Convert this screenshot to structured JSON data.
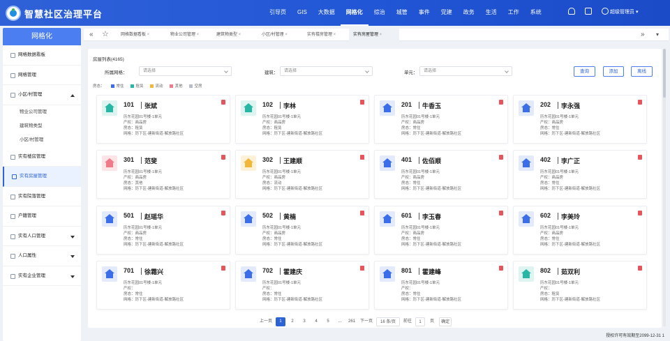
{
  "app": {
    "title": "智慧社区治理平台",
    "user": "超级管理员"
  },
  "nav": [
    "引导页",
    "GIS",
    "大数据",
    "网格化",
    "综治",
    "城管",
    "事件",
    "党建",
    "政务",
    "生活",
    "工作",
    "系统"
  ],
  "nav_active": 3,
  "sidebar": {
    "title": "网格化",
    "items": [
      {
        "label": "网格数据看板"
      },
      {
        "label": "网格管理"
      },
      {
        "label": "小区/村管理",
        "caret": "up"
      },
      {
        "label": "物业公司管理",
        "sub": true
      },
      {
        "label": "建筑物类型",
        "sub": true
      },
      {
        "label": "小区/村管理",
        "sub": true
      },
      {
        "label": "实有楼房管理"
      },
      {
        "label": "实有房屋管理",
        "active": true
      },
      {
        "label": "实有院落管理"
      },
      {
        "label": "户籍管理"
      },
      {
        "label": "实有人口管理",
        "caret": "down"
      },
      {
        "label": "人口属性",
        "caret": "down"
      },
      {
        "label": "实有企业管理",
        "caret": "down"
      }
    ]
  },
  "tabs": [
    "网格数据看板",
    "物业公司管理",
    "建筑物类型",
    "小区/村管理",
    "实有楼房管理",
    "实有房屋管理"
  ],
  "tab_active": 5,
  "panel": {
    "title": "房屋列表(4165)",
    "filters": [
      {
        "label": "所属网格：",
        "placeholder": "请选择"
      },
      {
        "label": "建筑：",
        "placeholder": "请选择"
      },
      {
        "label": "单元：",
        "placeholder": "请选择"
      }
    ],
    "buttons": [
      "查询",
      "添加",
      "离线"
    ],
    "legend_label": "房态：",
    "legend": [
      {
        "label": "常住",
        "color": "#3b6ee8"
      },
      {
        "label": "租赁",
        "color": "#27b7a4"
      },
      {
        "label": "流动",
        "color": "#f2b63a"
      },
      {
        "label": "其他",
        "color": "#f07a8a"
      },
      {
        "label": "空房",
        "color": "#b8bec8"
      }
    ]
  },
  "line_labels": {
    "owner": "产权：",
    "status": "房态：",
    "grid": "网格："
  },
  "cards": [
    {
      "room": "101",
      "name": "张斌",
      "addr": "历东花园01号楼-1单元",
      "owner": "商品房",
      "status": "租赁",
      "grid": "历下区-建新街道-解放路社区",
      "color": "#27b7a4",
      "bg": "#ddf4f1"
    },
    {
      "room": "102",
      "name": "李林",
      "addr": "历东花园01号楼-1单元",
      "owner": "商品房",
      "status": "租赁",
      "grid": "历下区-建新街道-解放路社区",
      "color": "#27b7a4",
      "bg": "#ddf4f1"
    },
    {
      "room": "201",
      "name": "牛香玉",
      "addr": "历东花园01号楼-1单元",
      "owner": "商品房",
      "status": "常住",
      "grid": "历下区-建新街道-解放路社区",
      "color": "#3b6ee8",
      "bg": "#e2eafc"
    },
    {
      "room": "202",
      "name": "李永强",
      "addr": "历东花园01号楼-1单元",
      "owner": "商品房",
      "status": "常住",
      "grid": "历下区-建新街道-解放路社区",
      "color": "#3b6ee8",
      "bg": "#e2eafc"
    },
    {
      "room": "301",
      "name": "范斐",
      "addr": "历东花园01号楼-1单元",
      "owner": "商品房",
      "status": "其他",
      "grid": "历下区-建新街道-解放路社区",
      "color": "#f07a8a",
      "bg": "#fde4e7"
    },
    {
      "room": "302",
      "name": "王建顺",
      "addr": "历东花园01号楼-1单元",
      "owner": "商品房",
      "status": "流动",
      "grid": "历下区-建新街道-解放路社区",
      "color": "#f2b63a",
      "bg": "#fdf1d8"
    },
    {
      "room": "401",
      "name": "佐佰顺",
      "addr": "历东花园01号楼-1单元",
      "owner": "商品房",
      "status": "常住",
      "grid": "历下区-建新街道-解放路社区",
      "color": "#3b6ee8",
      "bg": "#e2eafc"
    },
    {
      "room": "402",
      "name": "李广正",
      "addr": "历东花园01号楼-1单元",
      "owner": "商品房",
      "status": "常住",
      "grid": "历下区-建新街道-解放路社区",
      "color": "#3b6ee8",
      "bg": "#e2eafc"
    },
    {
      "room": "501",
      "name": "赵瑶华",
      "addr": "历东花园01号楼-1单元",
      "owner": "商品房",
      "status": "常住",
      "grid": "历下区-建新街道-解放路社区",
      "color": "#3b6ee8",
      "bg": "#e2eafc"
    },
    {
      "room": "502",
      "name": "黄楠",
      "addr": "历东花园01号楼-1单元",
      "owner": "商品房",
      "status": "常住",
      "grid": "历下区-建新街道-解放路社区",
      "color": "#3b6ee8",
      "bg": "#e2eafc"
    },
    {
      "room": "601",
      "name": "李玉春",
      "addr": "历东花园01号楼-1单元",
      "owner": "商品房",
      "status": "常住",
      "grid": "历下区-建新街道-解放路社区",
      "color": "#3b6ee8",
      "bg": "#e2eafc"
    },
    {
      "room": "602",
      "name": "李美玲",
      "addr": "历东花园01号楼-1单元",
      "owner": "商品房",
      "status": "常住",
      "grid": "历下区-建新街道-解放路社区",
      "color": "#3b6ee8",
      "bg": "#e2eafc"
    },
    {
      "room": "701",
      "name": "徐霜兴",
      "addr": "历东花园01号楼-1单元",
      "owner": "",
      "status": "常住",
      "grid": "历下区-建新街道-解放路社区",
      "color": "#3b6ee8",
      "bg": "#e2eafc"
    },
    {
      "room": "702",
      "name": "霍建庆",
      "addr": "历东花园01号楼-1单元",
      "owner": "",
      "status": "常住",
      "grid": "历下区-建新街道-解放路社区",
      "color": "#3b6ee8",
      "bg": "#e2eafc"
    },
    {
      "room": "801",
      "name": "霍建峰",
      "addr": "历东花园01号楼-1单元",
      "owner": "",
      "status": "常住",
      "grid": "历下区-建新街道-解放路社区",
      "color": "#3b6ee8",
      "bg": "#e2eafc"
    },
    {
      "room": "802",
      "name": "茹双利",
      "addr": "历东花园01号楼-1单元",
      "owner": "",
      "status": "租赁",
      "grid": "历下区-建新街道-解放路社区",
      "color": "#27b7a4",
      "bg": "#ddf4f1"
    }
  ],
  "pager": {
    "prev": "上一页",
    "pages": [
      "1",
      "2",
      "3",
      "4",
      "5",
      "...",
      "261"
    ],
    "current": "1",
    "next": "下一页",
    "size": "16 条/页",
    "goto": "前往",
    "goto_value": "1",
    "unit": "页",
    "confirm": "确定"
  },
  "footer": "授权许可有效期至2099-12-31 1"
}
